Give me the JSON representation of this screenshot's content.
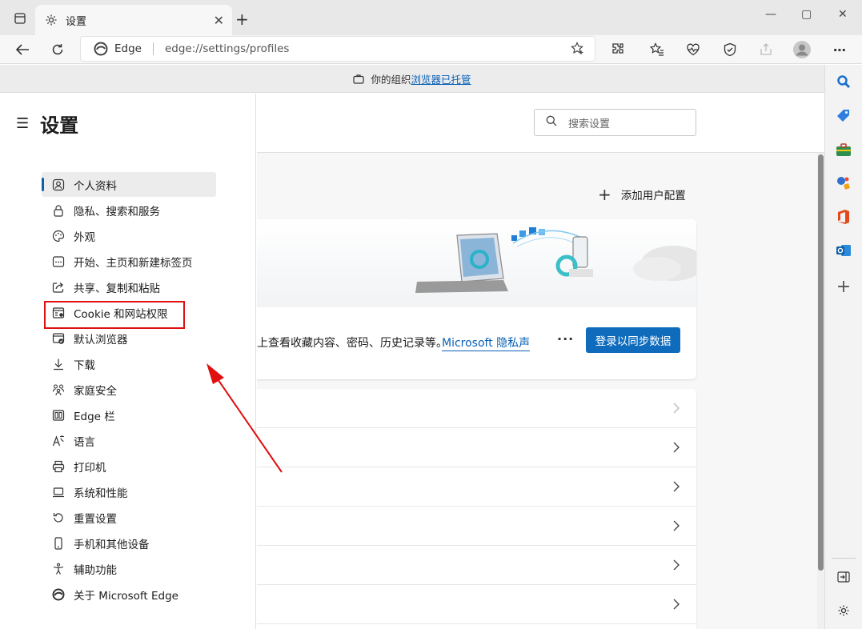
{
  "window": {
    "tab_title": "设置",
    "tab_close": "✕",
    "new_tab": "+",
    "minimize": "—",
    "maximize": "▢",
    "close": "✕"
  },
  "toolbar": {
    "site_name": "Edge",
    "url": "edge://settings/profiles",
    "more": "⋯"
  },
  "managed_bar": {
    "text": "你的组织",
    "link": "浏览器已托管"
  },
  "nav": {
    "title": "设置",
    "items": [
      {
        "label": "个人资料",
        "icon": "profile-icon",
        "active": true
      },
      {
        "label": "隐私、搜索和服务",
        "icon": "lock-icon"
      },
      {
        "label": "外观",
        "icon": "palette-icon"
      },
      {
        "label": "开始、主页和新建标签页",
        "icon": "newtab-icon"
      },
      {
        "label": "共享、复制和粘贴",
        "icon": "share-icon"
      },
      {
        "label": "Cookie 和网站权限",
        "icon": "cookie-icon"
      },
      {
        "label": "默认浏览器",
        "icon": "browser-icon"
      },
      {
        "label": "下载",
        "icon": "download-icon"
      },
      {
        "label": "家庭安全",
        "icon": "family-icon"
      },
      {
        "label": "Edge 栏",
        "icon": "edgebar-icon"
      },
      {
        "label": "语言",
        "icon": "language-icon"
      },
      {
        "label": "打印机",
        "icon": "printer-icon"
      },
      {
        "label": "系统和性能",
        "icon": "laptop-icon"
      },
      {
        "label": "重置设置",
        "icon": "reset-icon"
      },
      {
        "label": "手机和其他设备",
        "icon": "phone-icon"
      },
      {
        "label": "辅助功能",
        "icon": "accessibility-icon"
      },
      {
        "label": "关于 Microsoft Edge",
        "icon": "edge-logo-icon"
      }
    ]
  },
  "main": {
    "search_placeholder": "搜索设置",
    "add_profile": "添加用户配置",
    "card_text": "上查看收藏内容、密码、历史记录等。",
    "privacy_link": "Microsoft 隐私声",
    "more": "···",
    "sync_button": "登录以同步数据"
  },
  "colors": {
    "accent": "#0f6cbd",
    "highlight": "#e01010"
  }
}
